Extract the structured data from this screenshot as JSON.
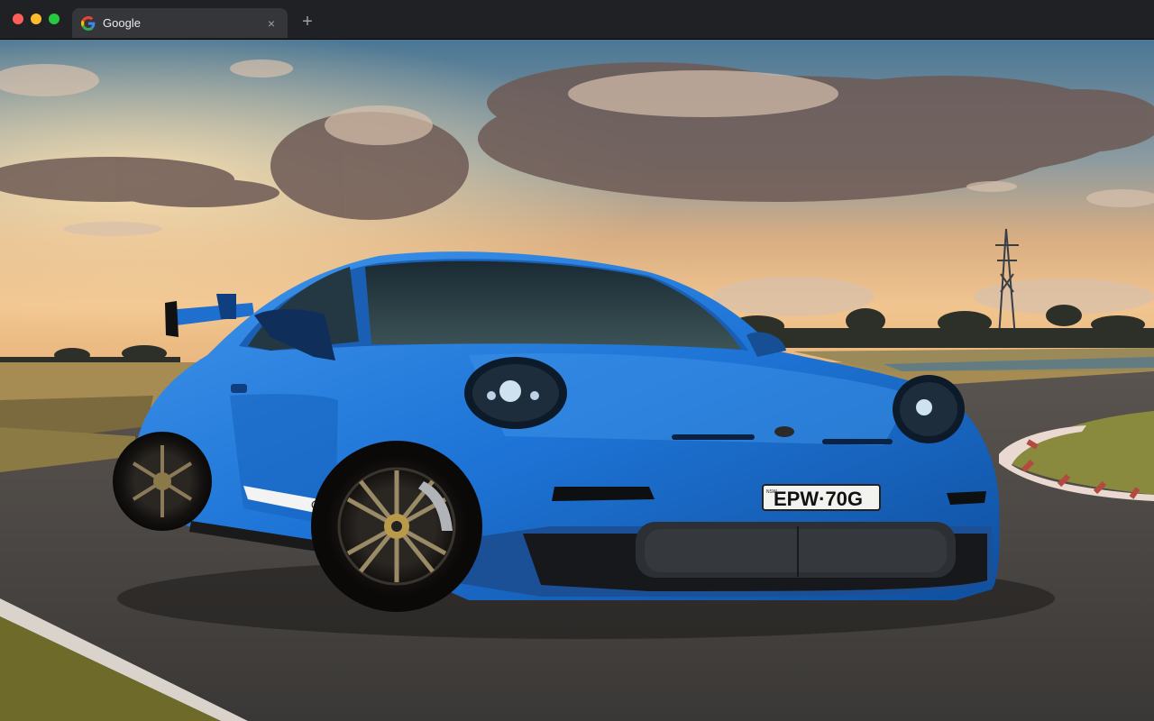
{
  "window": {
    "controls": [
      "close",
      "minimize",
      "maximize"
    ]
  },
  "tab": {
    "title": "Google",
    "favicon": "google-g-icon",
    "close_glyph": "×"
  },
  "new_tab": {
    "glyph": "+"
  },
  "wallpaper": {
    "plate_text": "EPW·70G",
    "badge_text": "GT3",
    "plate_state": "NSW",
    "colors": {
      "car": "#1e74d6",
      "sky_top": "#4b7795",
      "sky_glow": "#e9b57d",
      "road": "#4a4744"
    }
  }
}
